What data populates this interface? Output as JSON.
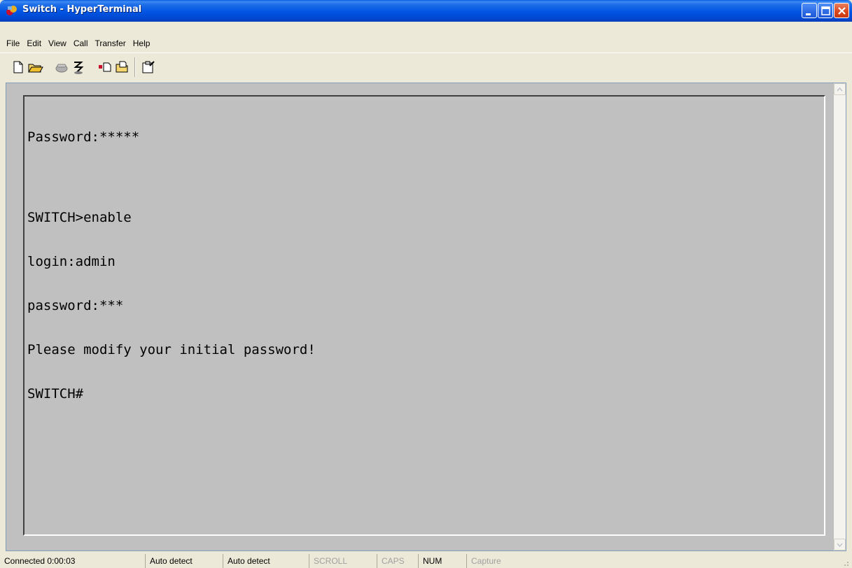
{
  "window": {
    "title": "Switch - HyperTerminal",
    "title_color": "#0054e3"
  },
  "menu": {
    "items": [
      "File",
      "Edit",
      "View",
      "Call",
      "Transfer",
      "Help"
    ]
  },
  "toolbar": {
    "buttons": [
      {
        "icon": "new-document-icon"
      },
      {
        "icon": "open-folder-icon"
      },
      {
        "icon": "phone-icon"
      },
      {
        "icon": "disconnect-icon"
      },
      {
        "icon": "send-icon"
      },
      {
        "icon": "receive-icon"
      },
      {
        "icon": "properties-icon"
      }
    ]
  },
  "terminal": {
    "background": "#c0c0c0",
    "lines": [
      "Password:*****",
      "",
      "SWITCH>enable",
      "login:admin",
      "password:***",
      "Please modify your initial password!",
      "SWITCH#"
    ]
  },
  "status": {
    "connected": "Connected 0:00:03",
    "detect1": "Auto detect",
    "detect2": "Auto detect",
    "scroll": "SCROLL",
    "caps": "CAPS",
    "num": "NUM",
    "capture": "Capture"
  }
}
